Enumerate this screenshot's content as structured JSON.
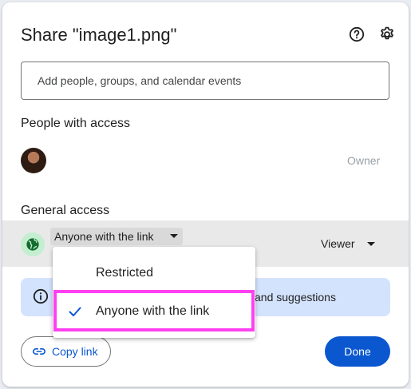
{
  "dialog": {
    "title": "Share \"image1.png\"",
    "help_icon": "help-circle-icon",
    "settings_icon": "gear-icon"
  },
  "search": {
    "placeholder": "Add people, groups, and calendar events"
  },
  "people": {
    "section_title": "People with access",
    "owner_label": "Owner"
  },
  "general_access": {
    "section_title": "General access",
    "selected": "Anyone with the link",
    "role": "Viewer"
  },
  "dropdown": {
    "options": [
      "Restricted",
      "Anyone with the link"
    ],
    "checked_index": 1
  },
  "info_banner": {
    "visible_text": "and suggestions"
  },
  "footer": {
    "copy_link_label": "Copy link",
    "done_label": "Done"
  },
  "colors": {
    "primary": "#0b57d0",
    "info_banner_bg": "#d3e3fd",
    "highlight": "#ff40f0",
    "globe_bg": "#c4eed0"
  }
}
